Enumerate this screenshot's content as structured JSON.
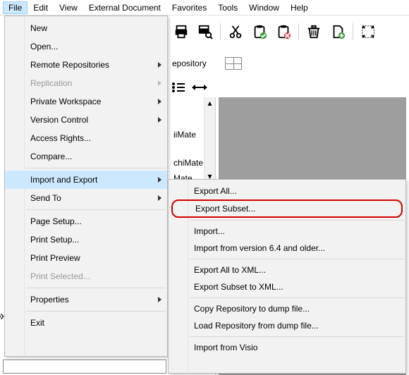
{
  "menubar": {
    "items": [
      "File",
      "Edit",
      "View",
      "External Document",
      "Favorites",
      "Tools",
      "Window",
      "Help"
    ],
    "active_index": 0
  },
  "toolbar": {
    "icons": [
      "print-icon",
      "print-search-icon",
      "cut-icon",
      "paste-icon",
      "paste-cancel-icon",
      "trash-icon",
      "page-add-icon",
      "fit-icon"
    ]
  },
  "band2": {
    "label": "epository",
    "icon": "grid-icon"
  },
  "band3": {
    "icons": [
      "bullet-list-icon",
      "arrows-horiz-icon"
    ]
  },
  "tree": {
    "items": [
      "iiMate",
      "chiMate",
      "Mate"
    ]
  },
  "file_menu": {
    "groups": [
      [
        {
          "label": "New",
          "sub": false,
          "disabled": false
        },
        {
          "label": "Open...",
          "sub": false,
          "disabled": false
        },
        {
          "label": "Remote Repositories",
          "sub": true,
          "disabled": false
        },
        {
          "label": "Replication",
          "sub": true,
          "disabled": true
        },
        {
          "label": "Private Workspace",
          "sub": true,
          "disabled": false
        },
        {
          "label": "Version Control",
          "sub": true,
          "disabled": false
        },
        {
          "label": "Access Rights...",
          "sub": false,
          "disabled": false
        },
        {
          "label": "Compare...",
          "sub": false,
          "disabled": false
        }
      ],
      [
        {
          "label": "Import and Export",
          "sub": true,
          "disabled": false,
          "highlight": true
        },
        {
          "label": "Send To",
          "sub": true,
          "disabled": false
        }
      ],
      [
        {
          "label": "Page Setup...",
          "sub": false,
          "disabled": false
        },
        {
          "label": "Print Setup...",
          "sub": false,
          "disabled": false
        },
        {
          "label": "Print Preview",
          "sub": false,
          "disabled": false
        },
        {
          "label": "Print Selected...",
          "sub": false,
          "disabled": true
        }
      ],
      [
        {
          "label": "Properties",
          "sub": true,
          "disabled": false
        }
      ],
      [
        {
          "label": "Exit",
          "sub": false,
          "disabled": false
        }
      ]
    ]
  },
  "sub_menu": {
    "groups": [
      [
        {
          "label": "Export All..."
        },
        {
          "label": "Export Subset...",
          "highlight": true
        }
      ],
      [
        {
          "label": "Import..."
        },
        {
          "label": "Import from version 6.4 and older..."
        }
      ],
      [
        {
          "label": "Export All to XML..."
        },
        {
          "label": "Export Subset to XML..."
        }
      ],
      [
        {
          "label": "Copy Repository to dump file..."
        },
        {
          "label": "Load Repository from dump file..."
        }
      ],
      [
        {
          "label": "Import from Visio"
        }
      ]
    ]
  }
}
